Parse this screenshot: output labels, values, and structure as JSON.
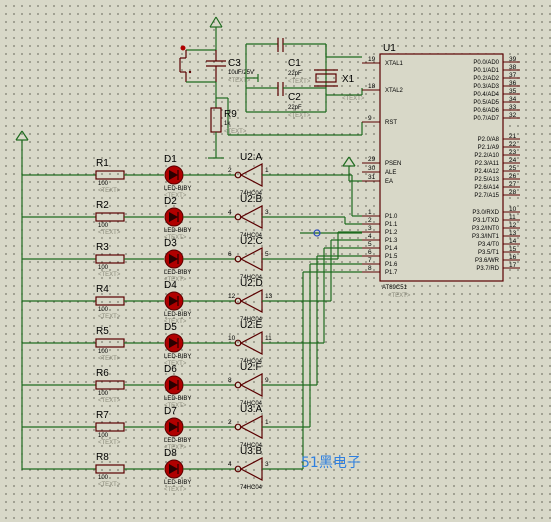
{
  "chip": {
    "ref": "U1",
    "part": "AT89C51",
    "text": "<TEXT>",
    "left_pins": [
      {
        "num": "19",
        "label": "XTAL1"
      },
      {
        "num": "18",
        "label": "XTAL2"
      },
      {
        "num": "9",
        "label": "RST"
      },
      {
        "num": "29",
        "label": "PSEN"
      },
      {
        "num": "30",
        "label": "ALE"
      },
      {
        "num": "31",
        "label": "EA"
      },
      {
        "num": "1",
        "label": "P1.0"
      },
      {
        "num": "2",
        "label": "P1.1"
      },
      {
        "num": "3",
        "label": "P1.2"
      },
      {
        "num": "4",
        "label": "P1.3"
      },
      {
        "num": "5",
        "label": "P1.4"
      },
      {
        "num": "6",
        "label": "P1.5"
      },
      {
        "num": "7",
        "label": "P1.6"
      },
      {
        "num": "8",
        "label": "P1.7"
      }
    ],
    "right_pins": [
      {
        "num": "39",
        "label": "P0.0/AD0"
      },
      {
        "num": "38",
        "label": "P0.1/AD1"
      },
      {
        "num": "37",
        "label": "P0.2/AD2"
      },
      {
        "num": "36",
        "label": "P0.3/AD3"
      },
      {
        "num": "35",
        "label": "P0.4/AD4"
      },
      {
        "num": "34",
        "label": "P0.5/AD5"
      },
      {
        "num": "33",
        "label": "P0.6/AD6"
      },
      {
        "num": "32",
        "label": "P0.7/AD7"
      },
      {
        "num": "21",
        "label": "P2.0/A8"
      },
      {
        "num": "22",
        "label": "P2.1/A9"
      },
      {
        "num": "23",
        "label": "P2.2/A10"
      },
      {
        "num": "24",
        "label": "P2.3/A11"
      },
      {
        "num": "25",
        "label": "P2.4/A12"
      },
      {
        "num": "26",
        "label": "P2.5/A13"
      },
      {
        "num": "27",
        "label": "P2.6/A14"
      },
      {
        "num": "28",
        "label": "P2.7/A15"
      },
      {
        "num": "10",
        "label": "P3.0/RXD"
      },
      {
        "num": "11",
        "label": "P3.1/TXD"
      },
      {
        "num": "12",
        "label": "P3.2/INT0"
      },
      {
        "num": "13",
        "label": "P3.3/INT1"
      },
      {
        "num": "14",
        "label": "P3.4/T0"
      },
      {
        "num": "15",
        "label": "P3.5/T1"
      },
      {
        "num": "16",
        "label": "P3.6/WR"
      },
      {
        "num": "17",
        "label": "P3.7/RD"
      }
    ]
  },
  "reset": {
    "c3": {
      "ref": "C3",
      "value": "10uF/25V",
      "text": "<TEXT>"
    },
    "r9": {
      "ref": "R9",
      "value": "1k",
      "text": "<TEXT>"
    }
  },
  "crystal": {
    "c1": {
      "ref": "C1",
      "value": "22pF",
      "text": "<TEXT>"
    },
    "c2": {
      "ref": "C2",
      "value": "22pF",
      "text": "<TEXT>"
    },
    "x1": {
      "ref": "X1",
      "text": "<TEXT>"
    }
  },
  "channels": [
    {
      "r": "R1",
      "rv": "100",
      "d": "D1",
      "dv": "LED-BIBY",
      "g": "U2:A",
      "in": "2",
      "out": "1",
      "gv": "74HC04"
    },
    {
      "r": "R2",
      "rv": "100",
      "d": "D2",
      "dv": "LED-BIBY",
      "g": "U2:B",
      "in": "4",
      "out": "3",
      "gv": "74HC04"
    },
    {
      "r": "R3",
      "rv": "100",
      "d": "D3",
      "dv": "LED-BIBY",
      "g": "U2:C",
      "in": "6",
      "out": "5",
      "gv": "74HC04"
    },
    {
      "r": "R4",
      "rv": "100",
      "d": "D4",
      "dv": "LED-BIBY",
      "g": "U2:D",
      "in": "12",
      "out": "13",
      "gv": "74HC04"
    },
    {
      "r": "R5",
      "rv": "100",
      "d": "D5",
      "dv": "LED-BIBY",
      "g": "U2:E",
      "in": "10",
      "out": "11",
      "gv": "74HC04"
    },
    {
      "r": "R6",
      "rv": "100",
      "d": "D6",
      "dv": "LED-BIBY",
      "g": "U2:F",
      "in": "8",
      "out": "9",
      "gv": "74HC04"
    },
    {
      "r": "R7",
      "rv": "100",
      "d": "D7",
      "dv": "LED-BIBY",
      "g": "U3:A",
      "in": "2",
      "out": "1",
      "gv": "74HC04"
    },
    {
      "r": "R8",
      "rv": "100",
      "d": "D8",
      "dv": "LED-BIBY",
      "g": "U3:B",
      "in": "4",
      "out": "3",
      "gv": "74HC04"
    }
  ],
  "text_placeholder": "<TEXT>",
  "watermark": "51黑电子"
}
